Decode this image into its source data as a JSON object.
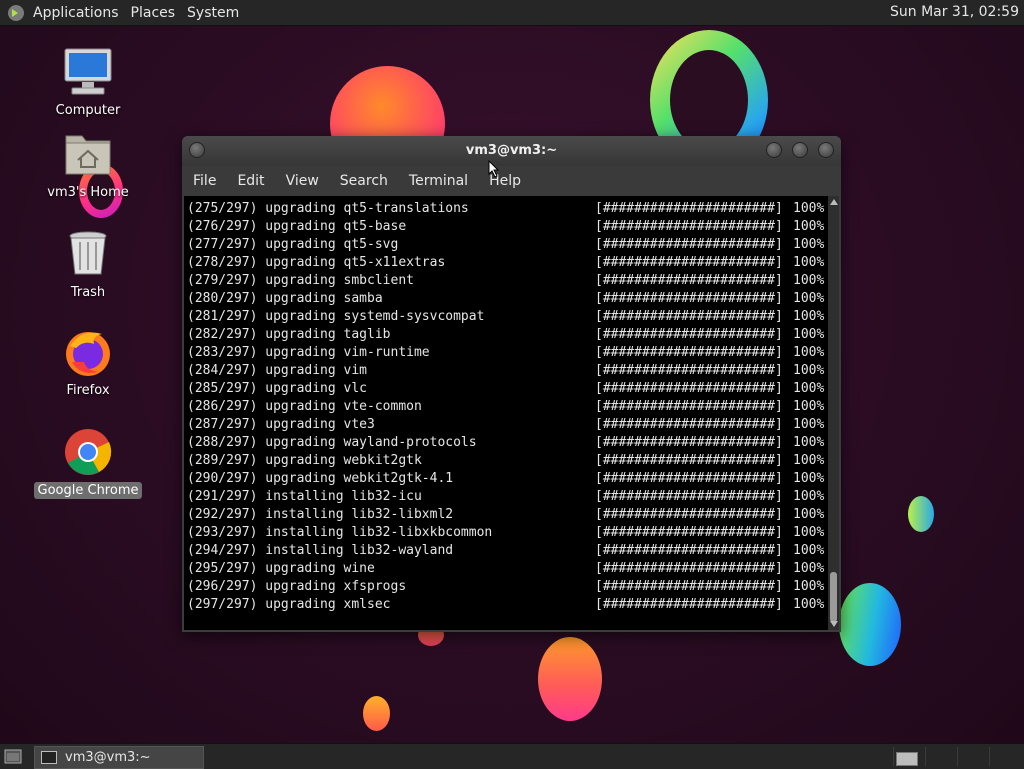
{
  "top_panel": {
    "menus": [
      "Applications",
      "Places",
      "System"
    ],
    "clock": "Sun Mar 31, 02:59"
  },
  "desktop_icons": [
    {
      "label": "Computer"
    },
    {
      "label": "vm3's Home"
    },
    {
      "label": "Trash"
    },
    {
      "label": "Firefox"
    },
    {
      "label": "Google Chrome"
    }
  ],
  "terminal": {
    "title": "vm3@vm3:~",
    "menus": [
      "File",
      "Edit",
      "View",
      "Search",
      "Terminal",
      "Help"
    ],
    "progress_bar": "[######################]",
    "progress_pct": "100%",
    "lines": [
      "(275/297) upgrading qt5-translations",
      "(276/297) upgrading qt5-base",
      "(277/297) upgrading qt5-svg",
      "(278/297) upgrading qt5-x11extras",
      "(279/297) upgrading smbclient",
      "(280/297) upgrading samba",
      "(281/297) upgrading systemd-sysvcompat",
      "(282/297) upgrading taglib",
      "(283/297) upgrading vim-runtime",
      "(284/297) upgrading vim",
      "(285/297) upgrading vlc",
      "(286/297) upgrading vte-common",
      "(287/297) upgrading vte3",
      "(288/297) upgrading wayland-protocols",
      "(289/297) upgrading webkit2gtk",
      "(290/297) upgrading webkit2gtk-4.1",
      "(291/297) installing lib32-icu",
      "(292/297) installing lib32-libxml2",
      "(293/297) installing lib32-libxkbcommon",
      "(294/297) installing lib32-wayland",
      "(295/297) upgrading wine",
      "(296/297) upgrading xfsprogs",
      "(297/297) upgrading xmlsec"
    ]
  },
  "bottom_panel": {
    "task_label": "vm3@vm3:~"
  },
  "colors": {
    "wallpaper": "#2b0d22",
    "panel": "#262626",
    "terminal_bg": "#000000",
    "terminal_fg": "#e6e6e6"
  }
}
